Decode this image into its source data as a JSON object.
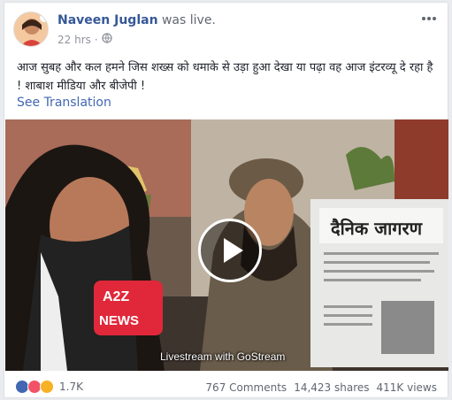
{
  "post": {
    "author": "Naveen Juglan",
    "action": "was live.",
    "time": "22 hrs",
    "privacy_icon": "globe-icon",
    "text": "आज सुबह और कल हमने जिस शख्स को धमाके से उड़ा हुआ देखा या पढ़ा वह आज इंटरव्यू दे रहा है ! शाबाश मीडिया और बीजेपी !",
    "see_translation": "See Translation"
  },
  "video": {
    "caption": "Livestream with GoStream",
    "newspaper_title": "दैनिक जागरण",
    "mic_label_top": "A2Z",
    "mic_label_bottom": "NEWS"
  },
  "footer": {
    "reaction_count": "1.7K",
    "comments": "767 Comments",
    "shares": "14,423 shares",
    "views": "411K views"
  },
  "colors": {
    "link": "#365899",
    "accent": "#4267b2",
    "muted": "#616770"
  }
}
